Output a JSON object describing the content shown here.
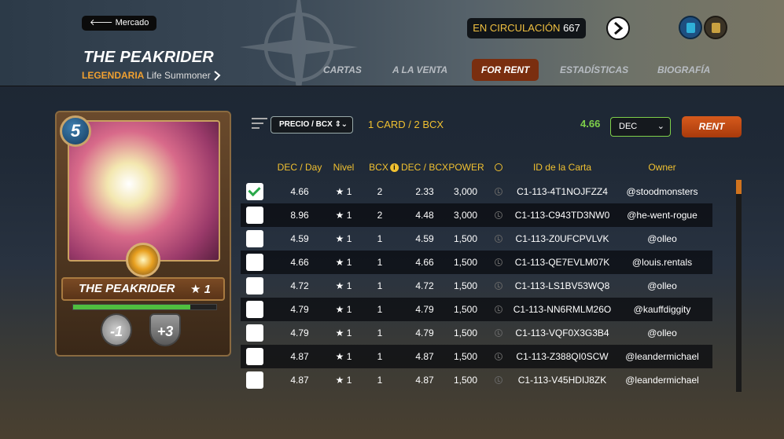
{
  "header": {
    "back_label": "Mercado",
    "card_name": "THE PEAKRIDER",
    "rarity": "LEGENDARIA",
    "type": "Life Summoner",
    "circulation_label": "EN CIRCULACIÓN",
    "circulation_value": "667",
    "tabs": [
      "CARTAS",
      "A LA VENTA",
      "FOR RENT",
      "ESTADÍSTICAS",
      "BIOGRAFÍA"
    ],
    "active_tab": "FOR RENT"
  },
  "card": {
    "mana": "5",
    "name": "THE PEAKRIDER",
    "level": "★ 1",
    "attack_mod": "-1",
    "armor_mod": "+3",
    "level_progress": 0.82
  },
  "controls": {
    "sort_label": "PRECIO / BCX ⇕",
    "card_count": "1 CARD / 2 BCX",
    "price": "4.66",
    "currency": "DEC",
    "rent_label": "RENT"
  },
  "table": {
    "headers": [
      "DEC / Day",
      "Nivel",
      "BCX",
      "DEC / BCX",
      "POWER",
      "ID de la Carta",
      "Owner"
    ],
    "rows": [
      {
        "checked": true,
        "dec_day": "4.66",
        "level": "★ 1",
        "bcx": "2",
        "dec_bcx": "2.33",
        "power": "3,000",
        "id": "C1-113-4T1NOJFZZ4",
        "owner": "@stoodmonsters"
      },
      {
        "checked": false,
        "dec_day": "8.96",
        "level": "★ 1",
        "bcx": "2",
        "dec_bcx": "4.48",
        "power": "3,000",
        "id": "C1-113-C943TD3NW0",
        "owner": "@he-went-rogue"
      },
      {
        "checked": false,
        "dec_day": "4.59",
        "level": "★ 1",
        "bcx": "1",
        "dec_bcx": "4.59",
        "power": "1,500",
        "id": "C1-113-Z0UFCPVLVK",
        "owner": "@olleo"
      },
      {
        "checked": false,
        "dec_day": "4.66",
        "level": "★ 1",
        "bcx": "1",
        "dec_bcx": "4.66",
        "power": "1,500",
        "id": "C1-113-QE7EVLM07K",
        "owner": "@louis.rentals"
      },
      {
        "checked": false,
        "dec_day": "4.72",
        "level": "★ 1",
        "bcx": "1",
        "dec_bcx": "4.72",
        "power": "1,500",
        "id": "C1-113-LS1BV53WQ8",
        "owner": "@olleo"
      },
      {
        "checked": false,
        "dec_day": "4.79",
        "level": "★ 1",
        "bcx": "1",
        "dec_bcx": "4.79",
        "power": "1,500",
        "id": "C1-113-NN6RMLM26O",
        "owner": "@kauffdiggity"
      },
      {
        "checked": false,
        "dec_day": "4.79",
        "level": "★ 1",
        "bcx": "1",
        "dec_bcx": "4.79",
        "power": "1,500",
        "id": "C1-113-VQF0X3G3B4",
        "owner": "@olleo"
      },
      {
        "checked": false,
        "dec_day": "4.87",
        "level": "★ 1",
        "bcx": "1",
        "dec_bcx": "4.87",
        "power": "1,500",
        "id": "C1-113-Z388QI0SCW",
        "owner": "@leandermichael"
      },
      {
        "checked": false,
        "dec_day": "4.87",
        "level": "★ 1",
        "bcx": "1",
        "dec_bcx": "4.87",
        "power": "1,500",
        "id": "C1-113-V45HDIJ8ZK",
        "owner": "@leandermichael"
      }
    ]
  },
  "colors": {
    "accent": "#f0c030",
    "price_green": "#7ed04a",
    "rent_orange": "#d65a1c",
    "active_tab": "#7a2e0f"
  }
}
